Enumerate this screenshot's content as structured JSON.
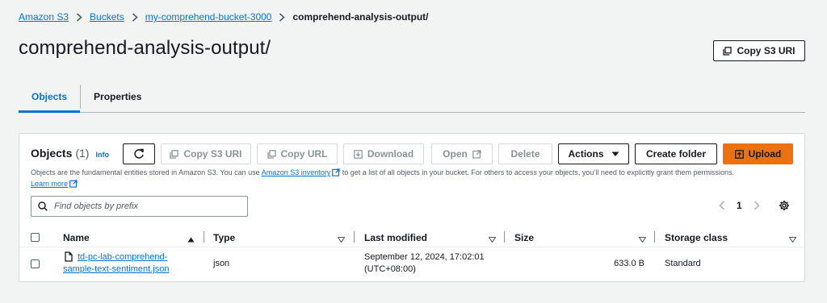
{
  "breadcrumb": {
    "items": [
      "Amazon S3",
      "Buckets",
      "my-comprehend-bucket-3000"
    ],
    "current": "comprehend-analysis-output/"
  },
  "page": {
    "title": "comprehend-analysis-output/",
    "copy_uri_label": "Copy S3 URI"
  },
  "tabs": [
    {
      "label": "Objects",
      "active": true
    },
    {
      "label": "Properties",
      "active": false
    }
  ],
  "objects_panel": {
    "title": "Objects",
    "count": "(1)",
    "info": "Info",
    "toolbar": {
      "refresh_icon": "refresh-icon",
      "copy_s3_uri": "Copy S3 URI",
      "copy_url": "Copy URL",
      "download": "Download",
      "open": "Open",
      "delete": "Delete",
      "actions": "Actions",
      "create_folder": "Create folder",
      "upload": "Upload"
    },
    "description": {
      "before": "Objects are the fundamental entities stored in Amazon S3. You can use ",
      "inventory_link": "Amazon S3 inventory",
      "after": " to get a list of all objects in your bucket. For others to access your objects, you’ll need to explicitly grant them permissions.",
      "learn_more": "Learn more"
    },
    "search": {
      "placeholder": "Find objects by prefix",
      "value": ""
    },
    "pagination": {
      "page": "1"
    },
    "columns": [
      "Name",
      "Type",
      "Last modified",
      "Size",
      "Storage class"
    ],
    "rows": [
      {
        "name_line1": "td-pc-lab-comprehend-",
        "name_line2": "sample-text-sentiment.json",
        "type": "json",
        "last_modified_line1": "September 12, 2024, 17:02:01",
        "last_modified_line2": "(UTC+08:00)",
        "size": "633.0 B",
        "storage_class": "Standard"
      }
    ]
  },
  "colors": {
    "link": "#0972d3",
    "primary": "#ec7211",
    "background": "#f2f3f3",
    "border": "#d5dbdb"
  }
}
